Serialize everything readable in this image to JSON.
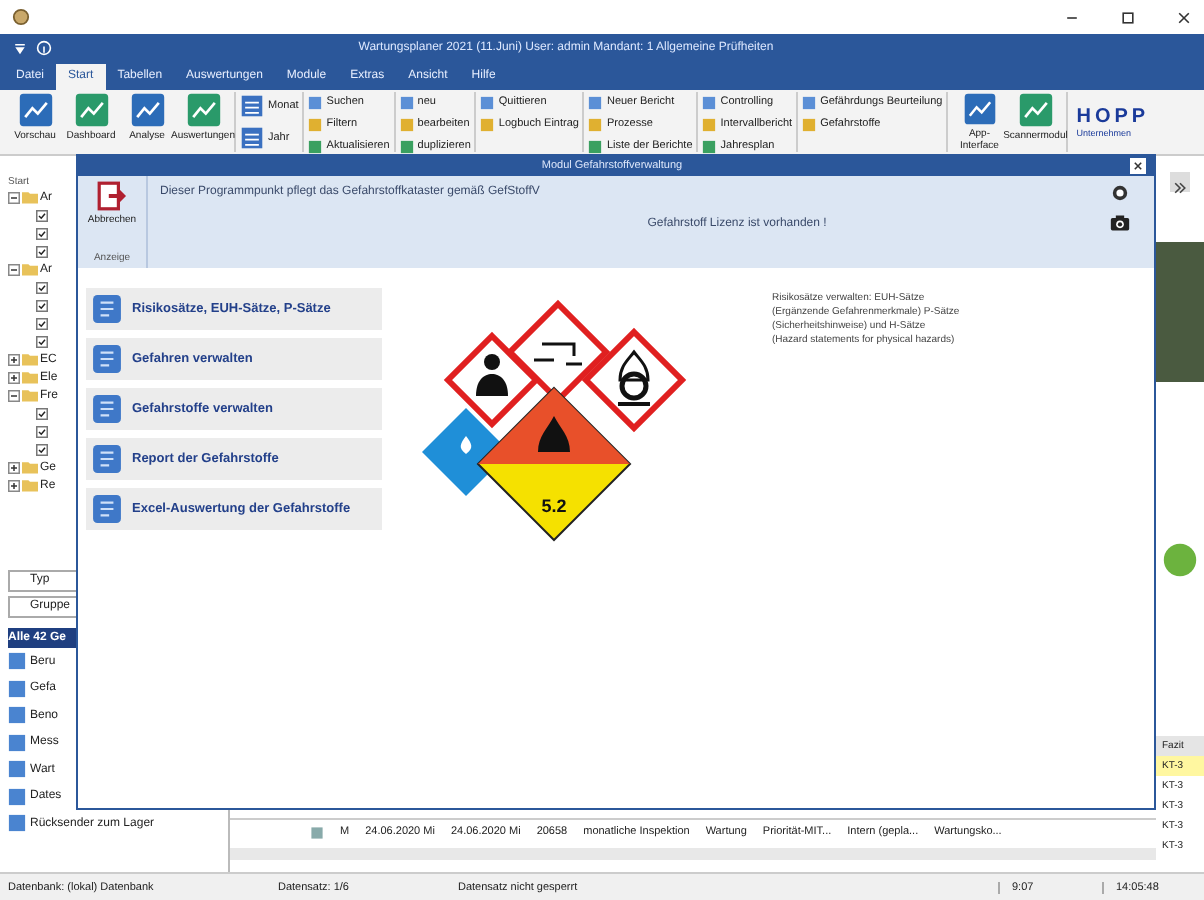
{
  "window": {
    "title": "Wartungsplaner 2021 (11.Juni)  User: admin  Mandant: 1 Allgemeine Prüfheiten"
  },
  "menu_tabs": [
    {
      "label": "Datei",
      "selected": false
    },
    {
      "label": "Start",
      "selected": true
    },
    {
      "label": "Tabellen",
      "selected": false
    },
    {
      "label": "Auswertungen",
      "selected": false
    },
    {
      "label": "Module",
      "selected": false
    },
    {
      "label": "Extras",
      "selected": false
    },
    {
      "label": "Ansicht",
      "selected": false
    },
    {
      "label": "Hilfe",
      "selected": false
    }
  ],
  "ribbon": [
    {
      "kind": "large",
      "items": [
        "Vorschau",
        "Dashboard",
        "Analyse",
        "Auswertungen"
      ]
    },
    {
      "kind": "medium",
      "items": [
        "Monat",
        "Jahr"
      ]
    },
    {
      "kind": "small",
      "items": [
        "Suchen",
        "Filtern",
        "Aktualisieren"
      ]
    },
    {
      "kind": "small",
      "items": [
        "neu",
        "bearbeiten",
        "duplizieren"
      ]
    },
    {
      "kind": "small",
      "items": [
        "Quittieren",
        "Logbuch Eintrag"
      ]
    },
    {
      "kind": "small",
      "items": [
        "Neuer Bericht",
        "Prozesse",
        "Liste der Berichte"
      ]
    },
    {
      "kind": "small",
      "items": [
        "Controlling",
        "Intervallbericht",
        "Jahresplan"
      ]
    },
    {
      "kind": "small",
      "items": [
        "Gefährdungs Beurteilung",
        "Gefahrstoffe"
      ]
    },
    {
      "kind": "large",
      "items": [
        "App-Interface",
        "Scannermodul"
      ]
    }
  ],
  "logo": {
    "name": "HOPP",
    "tagline": "Unternehmen"
  },
  "sidebar": {
    "header": "Start",
    "tree": [
      {
        "label": "Ar",
        "expanded": true,
        "children": [
          {
            "checked": true
          },
          {
            "checked": true
          },
          {
            "checked": true
          }
        ]
      },
      {
        "label": "Ar",
        "expanded": true,
        "children": [
          {
            "checked": true
          },
          {
            "checked": true
          },
          {
            "checked": true
          },
          {
            "checked": true
          }
        ]
      },
      {
        "label": "EC",
        "expanded": false
      },
      {
        "label": "Ele",
        "expanded": false
      },
      {
        "label": "Fre",
        "expanded": true,
        "children": [
          {
            "checked": true
          },
          {
            "checked": true
          },
          {
            "checked": true
          }
        ]
      },
      {
        "label": "Ge",
        "expanded": false
      },
      {
        "label": "Re",
        "expanded": false
      }
    ],
    "filters": [
      "Typ",
      "Gruppe"
    ],
    "list_header": "Alle 42 Ge",
    "list": [
      "Beru",
      "Gefa",
      "Beno",
      "Mess",
      "Wart",
      "Dates",
      "Rücksender zum Lager"
    ]
  },
  "table_row": [
    "M",
    "24.06.2020 Mi",
    "24.06.2020 Mi",
    "20658",
    "monatliche Inspektion",
    "Wartung",
    "Priorität-MIT...",
    "Intern (gepla...",
    "Wartungsko..."
  ],
  "right_panel": {
    "column": "Fazit",
    "values": [
      {
        "text": "KT-3",
        "selected": true
      },
      {
        "text": "KT-3",
        "selected": false
      },
      {
        "text": "KT-3",
        "selected": false
      },
      {
        "text": "KT-3",
        "selected": false
      },
      {
        "text": "KT-3",
        "selected": false
      }
    ]
  },
  "modal": {
    "title": "Modul Gefahrstoffverwaltung",
    "cancel": "Abbrechen",
    "group": "Anzeige",
    "description": "Dieser Programmpunkt pflegt das Gefahrstoffkataster gemäß GefStoffV",
    "license": "Gefahrstoff Lizenz ist vorhanden !",
    "menu": [
      "Risikosätze, EUH-Sätze, P-Sätze",
      "Gefahren verwalten",
      "Gefahrstoffe verwalten",
      "Report der Gefahrstoffe",
      "Excel-Auswertung der Gefahrstoffe"
    ],
    "class_number": "5.2",
    "info": [
      "Risikosätze verwalten: EUH-Sätze",
      "(Ergänzende Gefahrenmerkmale) P-Sätze",
      "(Sicherheitshinweise) und H-Sätze",
      "(Hazard statements for physical hazards)"
    ]
  },
  "status_bar": [
    "Datenbank: (lokal) Datenbank",
    "Datensatz: 1/6",
    "Datensatz nicht gesperrt",
    "9:07",
    "14:05:48"
  ]
}
